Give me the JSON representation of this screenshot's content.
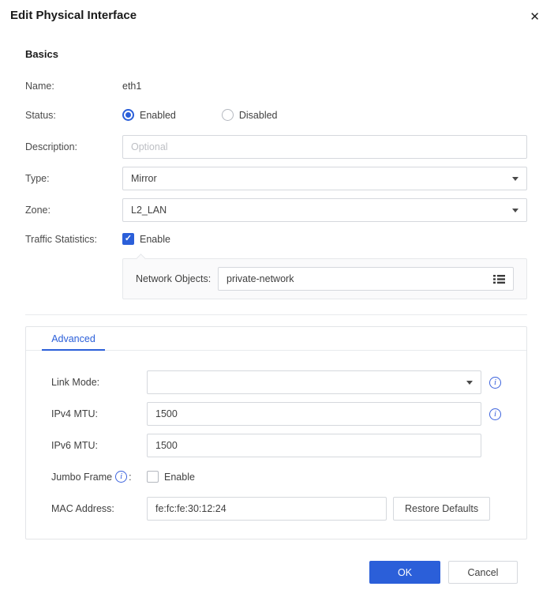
{
  "dialog": {
    "title": "Edit Physical Interface",
    "close_icon": "✕"
  },
  "basics": {
    "heading": "Basics",
    "name_label": "Name:",
    "name_value": "eth1",
    "status_label": "Status:",
    "status_enabled": "Enabled",
    "status_disabled": "Disabled",
    "status_selected": "Enabled",
    "description_label": "Description:",
    "description_placeholder": "Optional",
    "type_label": "Type:",
    "type_value": "Mirror",
    "zone_label": "Zone:",
    "zone_value": "L2_LAN",
    "traffic_label": "Traffic Statistics:",
    "traffic_enable_label": "Enable",
    "traffic_enabled": true,
    "network_objects_label": "Network Objects:",
    "network_objects_value": "private-network"
  },
  "advanced": {
    "tab": "Advanced",
    "link_mode_label": "Link Mode:",
    "link_mode_value": "",
    "ipv4_mtu_label": "IPv4 MTU:",
    "ipv4_mtu_value": "1500",
    "ipv6_mtu_label": "IPv6 MTU:",
    "ipv6_mtu_value": "1500",
    "jumbo_label": "Jumbo Frame",
    "jumbo_colon": ":",
    "jumbo_enable_label": "Enable",
    "jumbo_enabled": false,
    "mac_label": "MAC Address:",
    "mac_value": "fe:fc:fe:30:12:24",
    "restore_defaults_label": "Restore Defaults"
  },
  "footer": {
    "ok": "OK",
    "cancel": "Cancel"
  },
  "colors": {
    "primary_blue": "#2b5fd9",
    "info_icon_blue": "#3b62dd",
    "panel_bg": "#fafafb",
    "border_gray": "#d5d8dd"
  }
}
